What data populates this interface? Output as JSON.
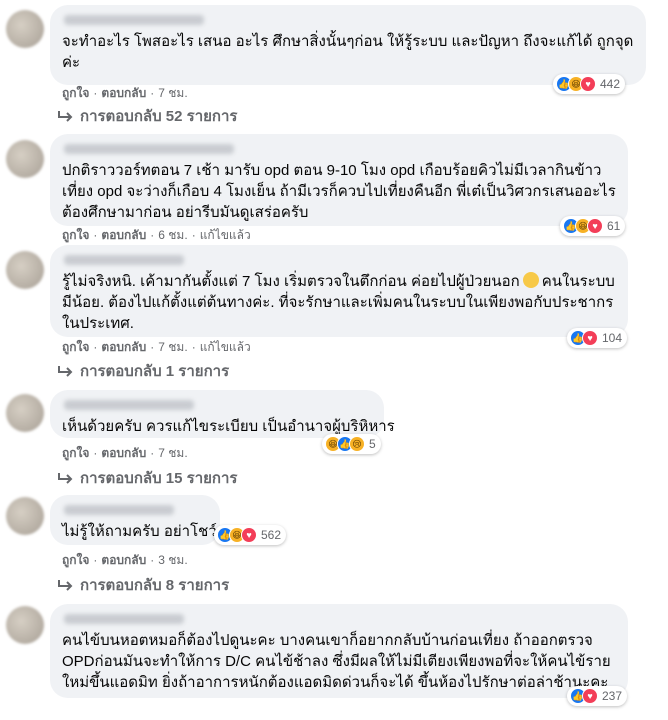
{
  "comments": [
    {
      "text": "จะทำอะไร โพสอะไร เสนอ อะไร ศึกษาสิ่งนั้นๆก่อน ให้รู้ระบบ และปัญหา ถึงจะแก้ได้ ถูกจุดค่ะ",
      "reactions": {
        "icons": [
          "like-icon",
          "haha-icon",
          "love-icon"
        ],
        "count": "442"
      },
      "actions": {
        "like": "ถูกใจ",
        "reply": "ตอบกลับ",
        "time": "7 ชม.",
        "edited": ""
      },
      "replies": "การตอบกลับ 52 รายการ"
    },
    {
      "text": "ปกติราววอร์ทตอน 7 เช้า มารับ opd ตอน 9-10 โมง opd เกือบร้อยคิวไม่มีเวลากินข้าวเที่ยง opd จะว่างก็เกือบ 4 โมงเย็น ถ้ามีเวรก็ควบไปเที่ยงคืนอีก พี่เต๋เป็นวิศวกรเสนออะไรต้องศึกษามาก่อน อย่ารีบมันดูเสร่อครับ",
      "reactions": {
        "icons": [
          "like-icon",
          "haha-icon",
          "love-icon"
        ],
        "count": "61"
      },
      "actions": {
        "like": "ถูกใจ",
        "reply": "ตอบกลับ",
        "time": "6 ชม.",
        "edited": "แก้ไขแล้ว"
      },
      "replies": ""
    },
    {
      "text_before_emoji": "รู้ไม่จริงหนิ. เค้ามากันตั้งแต่ 7 โมง เริ่มตรวจในตึกก่อน ค่อยไปผู้ป่วยนอก",
      "text_after_emoji": "คนในระบบมีน้อย. ต้องไปแก้ตั้งแต่ต้นทางค่ะ. ที่จะรักษาและเพิ่มคนในระบบในเพียงพอกับประชากรในประเทศ.",
      "reactions": {
        "icons": [
          "like-icon",
          "love-icon"
        ],
        "count": "104"
      },
      "actions": {
        "like": "ถูกใจ",
        "reply": "ตอบกลับ",
        "time": "7 ชม.",
        "edited": "แก้ไขแล้ว"
      },
      "replies": "การตอบกลับ 1 รายการ"
    },
    {
      "text": "เห็นด้วยครับ ควรแก้ไขระเบียบ เป็นอำนาจผู้บริหิหาร",
      "reactions": {
        "icons": [
          "haha-icon",
          "like-icon",
          "sad-icon"
        ],
        "count": "5"
      },
      "actions": {
        "like": "ถูกใจ",
        "reply": "ตอบกลับ",
        "time": "7 ชม.",
        "edited": ""
      },
      "replies": "การตอบกลับ 15 รายการ"
    },
    {
      "text": "ไม่รู้ให้ถามครับ อย่าโชว์...",
      "reactions": {
        "icons": [
          "like-icon",
          "haha-icon",
          "love-icon"
        ],
        "count": "562"
      },
      "actions": {
        "like": "ถูกใจ",
        "reply": "ตอบกลับ",
        "time": "3 ชม.",
        "edited": ""
      },
      "replies": "การตอบกลับ 8 รายการ"
    },
    {
      "text": "คนไข้บนหอตหมอก็ต้องไปดูนะคะ บางคนเขาก็อยากกลับบ้านก่อนเที่ยง ถ้าออกตรวจ OPDก่อนมันจะทำให้การ D/C คนไข้ช้าลง ซึ่งมีผลให้ไม่มีเตียงเพียงพอที่จะให้คนไข้รายใหม่ขึ้นแอดมิท ยิ่งถ้าอาการหนักต้องแอดมิดด่วนก็จะได้ ขึ้นห้องไปรักษาต่อล่าช้านะคะ",
      "reactions": {
        "icons": [
          "like-icon",
          "love-icon"
        ],
        "count": "237"
      },
      "actions": {
        "like": "",
        "reply": "",
        "time": "",
        "edited": ""
      },
      "replies": ""
    }
  ],
  "colors": {
    "bubble": "#f0f2f5",
    "secondary_text": "#65676b",
    "like": "#1877f2",
    "love": "#f33e58"
  }
}
